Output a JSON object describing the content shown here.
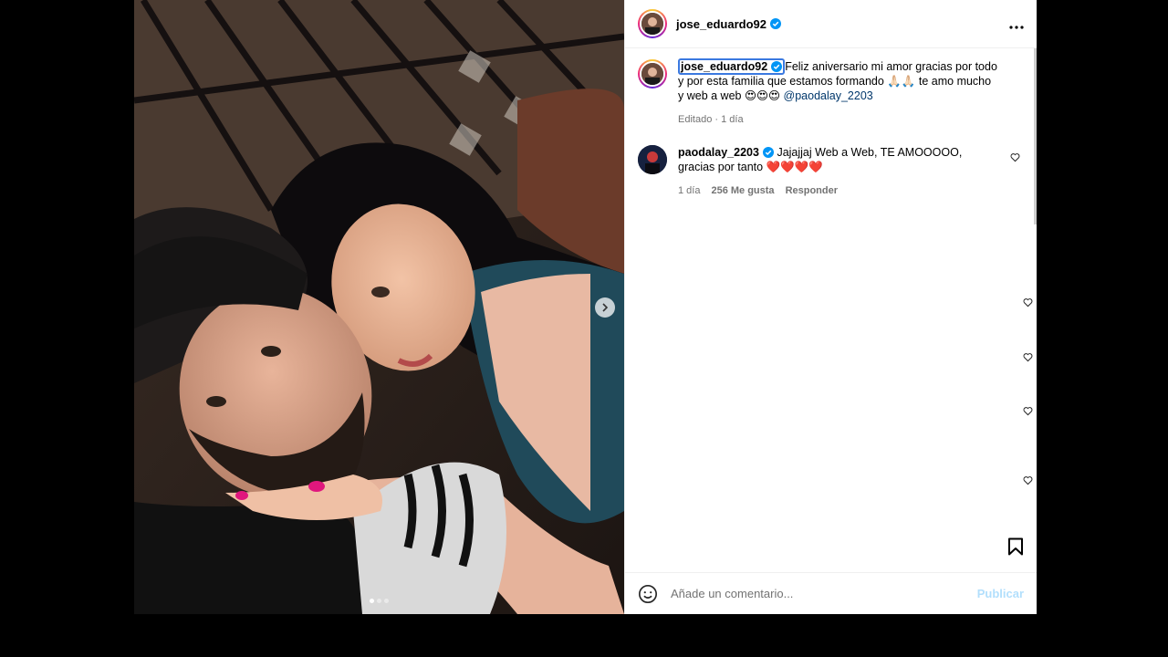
{
  "post": {
    "author": "jose_eduardo92",
    "more_icon": "more-horizontal-icon",
    "carousel": {
      "active_index": 0,
      "count": 3
    }
  },
  "caption": {
    "author": "jose_eduardo92",
    "text": "Feliz aniversario mi amor gracias por todo y por esta familia que estamos formando 🙏🏻🙏🏻 te amo mucho y web a web 😍😍😍 ",
    "mention": "@paodalay_2203",
    "edited": "Editado",
    "time": "1 día"
  },
  "comments": [
    {
      "author": "paodalay_2203",
      "text": "Jajajjaj Web a Web, TE AMOOOOO, gracias por tanto ❤️❤️❤️❤️",
      "time": "1 día",
      "likes": "256 Me gusta",
      "reply": "Responder"
    }
  ],
  "add_comment": {
    "placeholder": "Añade un comentario...",
    "publish": "Publicar"
  },
  "colors": {
    "verified": "#0095f6",
    "link": "#00376b",
    "publish_disabled": "#b2dffc"
  }
}
